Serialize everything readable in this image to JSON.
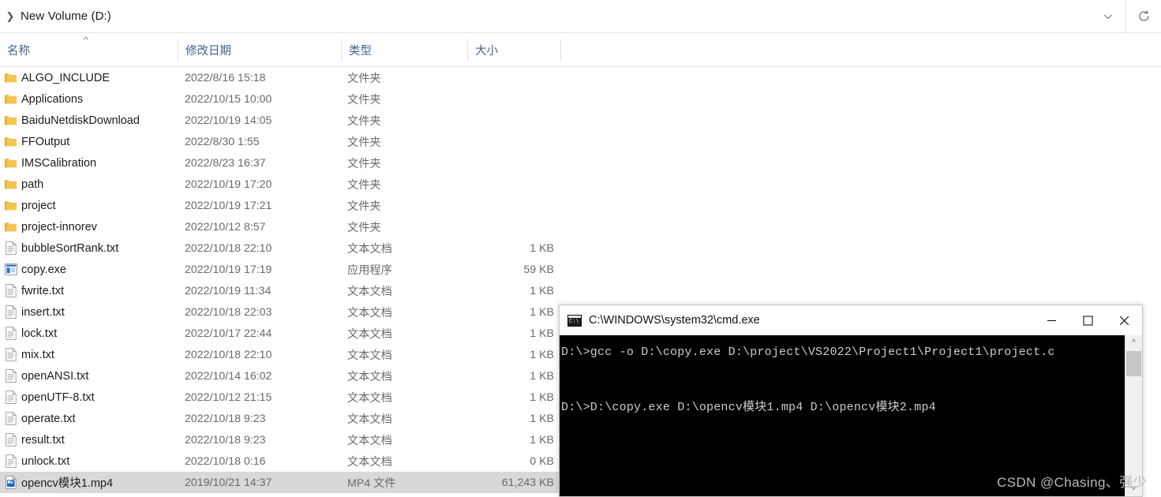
{
  "addressbar": {
    "chevron_icon": "chevron-right-icon",
    "path": "New Volume (D:)",
    "dropdown_icon": "chevron-down-icon",
    "refresh_icon": "refresh-icon"
  },
  "columns": [
    {
      "key": "name",
      "label": "名称",
      "sorted": true,
      "sort_icon": "sort-ascending-caret"
    },
    {
      "key": "date",
      "label": "修改日期"
    },
    {
      "key": "type",
      "label": "类型"
    },
    {
      "key": "size",
      "label": "大小"
    }
  ],
  "files": [
    {
      "icon": "folder-icon",
      "name": "ALGO_INCLUDE",
      "date": "2022/8/16 15:18",
      "type": "文件夹",
      "size": "",
      "selected": false
    },
    {
      "icon": "folder-icon",
      "name": "Applications",
      "date": "2022/10/15 10:00",
      "type": "文件夹",
      "size": "",
      "selected": false
    },
    {
      "icon": "folder-icon",
      "name": "BaiduNetdiskDownload",
      "date": "2022/10/19 14:05",
      "type": "文件夹",
      "size": "",
      "selected": false
    },
    {
      "icon": "folder-icon",
      "name": "FFOutput",
      "date": "2022/8/30 1:55",
      "type": "文件夹",
      "size": "",
      "selected": false
    },
    {
      "icon": "folder-icon",
      "name": "IMSCalibration",
      "date": "2022/8/23 16:37",
      "type": "文件夹",
      "size": "",
      "selected": false
    },
    {
      "icon": "folder-icon",
      "name": "path",
      "date": "2022/10/19 17:20",
      "type": "文件夹",
      "size": "",
      "selected": false
    },
    {
      "icon": "folder-icon",
      "name": "project",
      "date": "2022/10/19 17:21",
      "type": "文件夹",
      "size": "",
      "selected": false
    },
    {
      "icon": "folder-icon",
      "name": "project-innorev",
      "date": "2022/10/12 8:57",
      "type": "文件夹",
      "size": "",
      "selected": false
    },
    {
      "icon": "text-file-icon",
      "name": "bubbleSortRank.txt",
      "date": "2022/10/18 22:10",
      "type": "文本文档",
      "size": "1 KB",
      "selected": false
    },
    {
      "icon": "application-icon",
      "name": "copy.exe",
      "date": "2022/10/19 17:19",
      "type": "应用程序",
      "size": "59 KB",
      "selected": false
    },
    {
      "icon": "text-file-icon",
      "name": "fwrite.txt",
      "date": "2022/10/19 11:34",
      "type": "文本文档",
      "size": "1 KB",
      "selected": false
    },
    {
      "icon": "text-file-icon",
      "name": "insert.txt",
      "date": "2022/10/18 22:03",
      "type": "文本文档",
      "size": "1 KB",
      "selected": false
    },
    {
      "icon": "text-file-icon",
      "name": "lock.txt",
      "date": "2022/10/17 22:44",
      "type": "文本文档",
      "size": "1 KB",
      "selected": false
    },
    {
      "icon": "text-file-icon",
      "name": "mix.txt",
      "date": "2022/10/18 22:10",
      "type": "文本文档",
      "size": "1 KB",
      "selected": false
    },
    {
      "icon": "text-file-icon",
      "name": "openANSI.txt",
      "date": "2022/10/14 16:02",
      "type": "文本文档",
      "size": "1 KB",
      "selected": false
    },
    {
      "icon": "text-file-icon",
      "name": "openUTF-8.txt",
      "date": "2022/10/12 21:15",
      "type": "文本文档",
      "size": "1 KB",
      "selected": false
    },
    {
      "icon": "text-file-icon",
      "name": "operate.txt",
      "date": "2022/10/18 9:23",
      "type": "文本文档",
      "size": "1 KB",
      "selected": false
    },
    {
      "icon": "text-file-icon",
      "name": "result.txt",
      "date": "2022/10/18 9:23",
      "type": "文本文档",
      "size": "1 KB",
      "selected": false
    },
    {
      "icon": "text-file-icon",
      "name": "unlock.txt",
      "date": "2022/10/18 0:16",
      "type": "文本文档",
      "size": "0 KB",
      "selected": false
    },
    {
      "icon": "video-file-icon",
      "name": "opencv模块1.mp4",
      "date": "2019/10/21 14:37",
      "type": "MP4 文件",
      "size": "61,243 KB",
      "selected": true
    }
  ],
  "cmd_window": {
    "icon": "console-icon",
    "title": "C:\\WINDOWS\\system32\\cmd.exe",
    "minimize_label": "—",
    "maximize_label": "□",
    "close_label": "✕",
    "lines": [
      "D:\\>gcc -o D:\\copy.exe D:\\project\\VS2022\\Project1\\Project1\\project.c",
      "D:\\>D:\\copy.exe D:\\opencv模块1.mp4 D:\\opencv模块2.mp4"
    ],
    "console_text": "D:\\>gcc -o D:\\copy.exe D:\\project\\VS2022\\Project1\\Project1\\project.c\n\nD:\\>D:\\copy.exe D:\\opencv模块1.mp4 D:\\opencv模块2.mp4",
    "scroll_up_icon": "chevron-up-icon",
    "scroll_down_icon": "chevron-down-icon",
    "background_color": "#000000",
    "text_color": "#cccccc"
  },
  "watermark": {
    "text": "CSDN @Chasing、强少"
  },
  "colors": {
    "header_text": "#44618c",
    "folder_icon": "#f7ce6a",
    "selection": "#d8d8d8",
    "secondary_text": "#6a6a6a"
  }
}
